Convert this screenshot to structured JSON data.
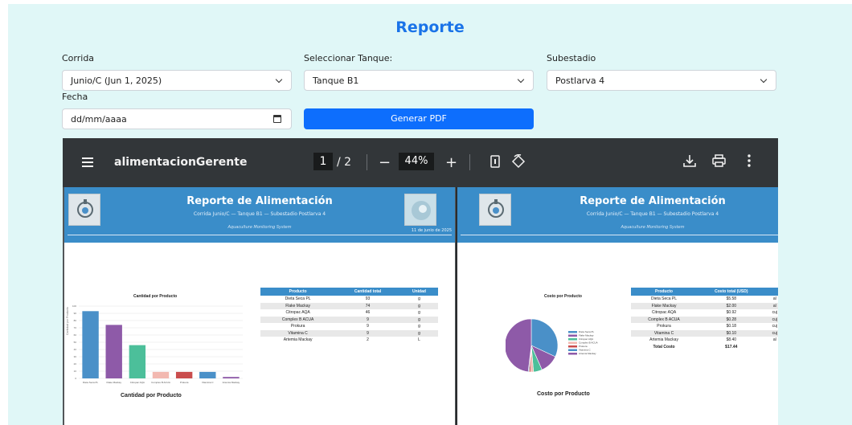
{
  "header": {
    "title": "Reporte"
  },
  "form": {
    "corrida_label": "Corrida",
    "corrida_value": "Junio/C (Jun 1, 2025)",
    "tanque_label": "Seleccionar Tanque:",
    "tanque_value": "Tanque B1",
    "subestadio_label": "Subestadio",
    "subestadio_value": "Postlarva 4",
    "fecha_label": "Fecha",
    "fecha_placeholder": "dd/mm/aaaa",
    "generate_label": "Generar PDF"
  },
  "viewer": {
    "filename": "alimentacionGerente",
    "page_current": "1",
    "page_total": "/ 2",
    "zoom": "44%"
  },
  "report": {
    "title": "Reporte de Alimentación",
    "subtitle": "Corrida Junio/C — Tanque B1 — Subestadio Postlarva 4",
    "system": "Aquaculture Monitoring System",
    "date": "11 de junio de 2025"
  },
  "page1": {
    "chart_title": "Cantidad por Producto",
    "chart_caption": "Cantidad por Producto",
    "ylabel": "Cantidad por Producto",
    "table_headers": [
      "Producto",
      "Cantidad total",
      "Unidad"
    ],
    "table_rows": [
      [
        "Dieta Seca PL",
        "93",
        "g"
      ],
      [
        "Flake Mackay",
        "74",
        "g"
      ],
      [
        "Citropac AQA",
        "46",
        "g"
      ],
      [
        "Complex B ACUA",
        "9",
        "g"
      ],
      [
        "Prokura",
        "9",
        "g"
      ],
      [
        "Vitamina C",
        "9",
        "g"
      ],
      [
        "Artemia Mackay",
        "2",
        "L"
      ]
    ]
  },
  "page2": {
    "chart_title": "Costo por Producto",
    "chart_caption": "Costo por Producto",
    "table_headers": [
      "Producto",
      "Costo total (USD)"
    ],
    "table_rows": [
      [
        "Dieta Seca PL",
        "$5.58",
        "al"
      ],
      [
        "Flake Mackay",
        "$2.00",
        "al"
      ],
      [
        "Citropac AQA",
        "$0.92",
        "cuj"
      ],
      [
        "Complex B ACUA",
        "$0.28",
        "cuj"
      ],
      [
        "Prokura",
        "$0.18",
        "cuj"
      ],
      [
        "Vitamina C",
        "$0.10",
        "cuj"
      ],
      [
        "Artemia Mackay",
        "$8.40",
        "al"
      ]
    ],
    "total_label": "Total Costo",
    "total_value": "$17.44"
  },
  "chart_data": [
    {
      "type": "bar",
      "title": "Cantidad por Producto",
      "xlabel": "Cantidad por Producto",
      "ylabel": "Cantidad por Producto",
      "categories": [
        "Dieta Seca PL",
        "Flake Mackay",
        "Citropac AQA",
        "Complex B ACUA",
        "Prokura",
        "Vitamina C",
        "Artemia Mackay"
      ],
      "values": [
        93,
        74,
        46,
        9,
        9,
        9,
        2
      ],
      "colors": [
        "#4a90c8",
        "#8e5aa8",
        "#4cbf9a",
        "#f2b8b0",
        "#c94c4c",
        "#4a90c8",
        "#8e5aa8"
      ],
      "ylim": [
        0,
        100
      ],
      "yticks": [
        "0",
        "10",
        "20",
        "30",
        "40",
        "50",
        "60",
        "70",
        "80",
        "90",
        "100"
      ]
    },
    {
      "type": "pie",
      "title": "Costo por Producto",
      "categories": [
        "Dieta Seca PL",
        "Flake Mackay",
        "Citropac AQA",
        "Complex B ACUA",
        "Prokura",
        "Vitamina C",
        "Artemia Mackay"
      ],
      "values": [
        5.58,
        2.0,
        0.92,
        0.28,
        0.18,
        0.1,
        8.4
      ],
      "colors": [
        "#4a90c8",
        "#8e5aa8",
        "#4cbf9a",
        "#f2b8b0",
        "#c94c4c",
        "#4a90c8",
        "#8e5aa8"
      ]
    }
  ]
}
